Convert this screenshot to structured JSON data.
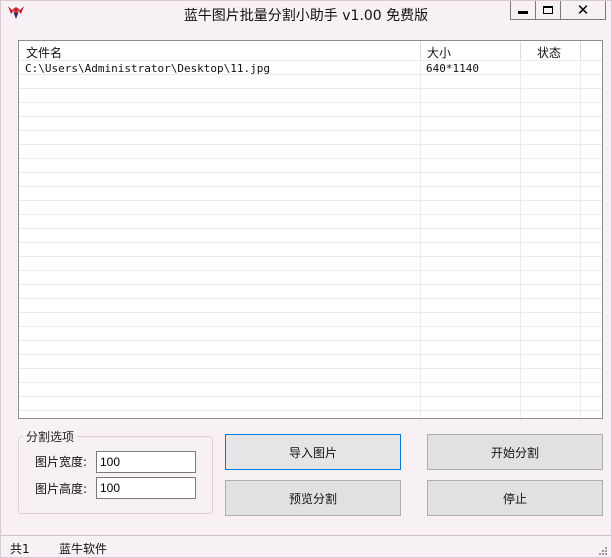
{
  "window": {
    "title": "蓝牛图片批量分割小助手 v1.00 免费版"
  },
  "file_list": {
    "columns": [
      "文件名",
      "大小",
      "状态"
    ],
    "rows": [
      {
        "file": "C:\\Users\\Administrator\\Desktop\\11.jpg",
        "size": "640*1140",
        "status": ""
      }
    ]
  },
  "options": {
    "group_label": "分割选项",
    "width_label": "图片宽度:",
    "width_value": "100",
    "height_label": "图片高度:",
    "height_value": "100"
  },
  "buttons": {
    "import": "导入图片",
    "start": "开始分割",
    "preview": "预览分割",
    "stop": "停止"
  },
  "status_bar": {
    "count": "共1",
    "brand": "蓝牛软件"
  },
  "colors": {
    "window_bg": "#f7f0f4",
    "focus_border": "#0078d7",
    "icon_red": "#cc1f2a",
    "icon_dark": "#2a2a6a"
  }
}
